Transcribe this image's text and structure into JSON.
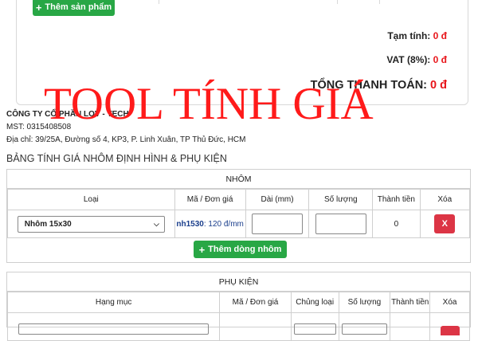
{
  "summary": {
    "add_product_label": "Thêm sản phẩm",
    "subtotal_label": "Tạm tính:",
    "subtotal_value": "0 đ",
    "vat_label": "VAT (8%):",
    "vat_value": "0 đ",
    "total_label": "TỔNG THANH TOÁN:",
    "total_value": "0 đ"
  },
  "watermark": "TOOL TÍNH GIÁ",
  "company": {
    "name": "CÔNG TY CỔ PHẦN LOV - TECH",
    "mst": "MST: 0315408508",
    "address": "Địa chỉ: 39/25A, Đường số 4, KP3, P. Linh Xuân, TP Thủ Đức, HCM"
  },
  "page_heading": "BẢNG TÍNH GIÁ NHÔM ĐỊNH HÌNH & PHỤ KIỆN",
  "nhom": {
    "title": "NHÔM",
    "columns": [
      "Loại",
      "Mã / Đơn giá",
      "Dài (mm)",
      "Số lượng",
      "Thành tiền",
      "Xóa"
    ],
    "rows": [
      {
        "type": "Nhôm 15x30",
        "code": "nh1530",
        "price": ": 120 đ/mm",
        "length": "",
        "qty": "",
        "total": "0",
        "delete_label": "X"
      }
    ],
    "add_row_label": "Thêm dòng nhôm"
  },
  "phukien": {
    "title": "PHỤ KIỆN",
    "columns": [
      "Hạng mục",
      "Mã / Đơn giá",
      "Chủng loại",
      "Số lượng",
      "Thành tiền",
      "Xóa"
    ]
  },
  "colors": {
    "accent_green": "#28a745",
    "danger_red": "#dc3545",
    "value_red": "#e8161b",
    "watermark_red": "#ff1a1a",
    "code_blue": "#1a3e8c"
  }
}
